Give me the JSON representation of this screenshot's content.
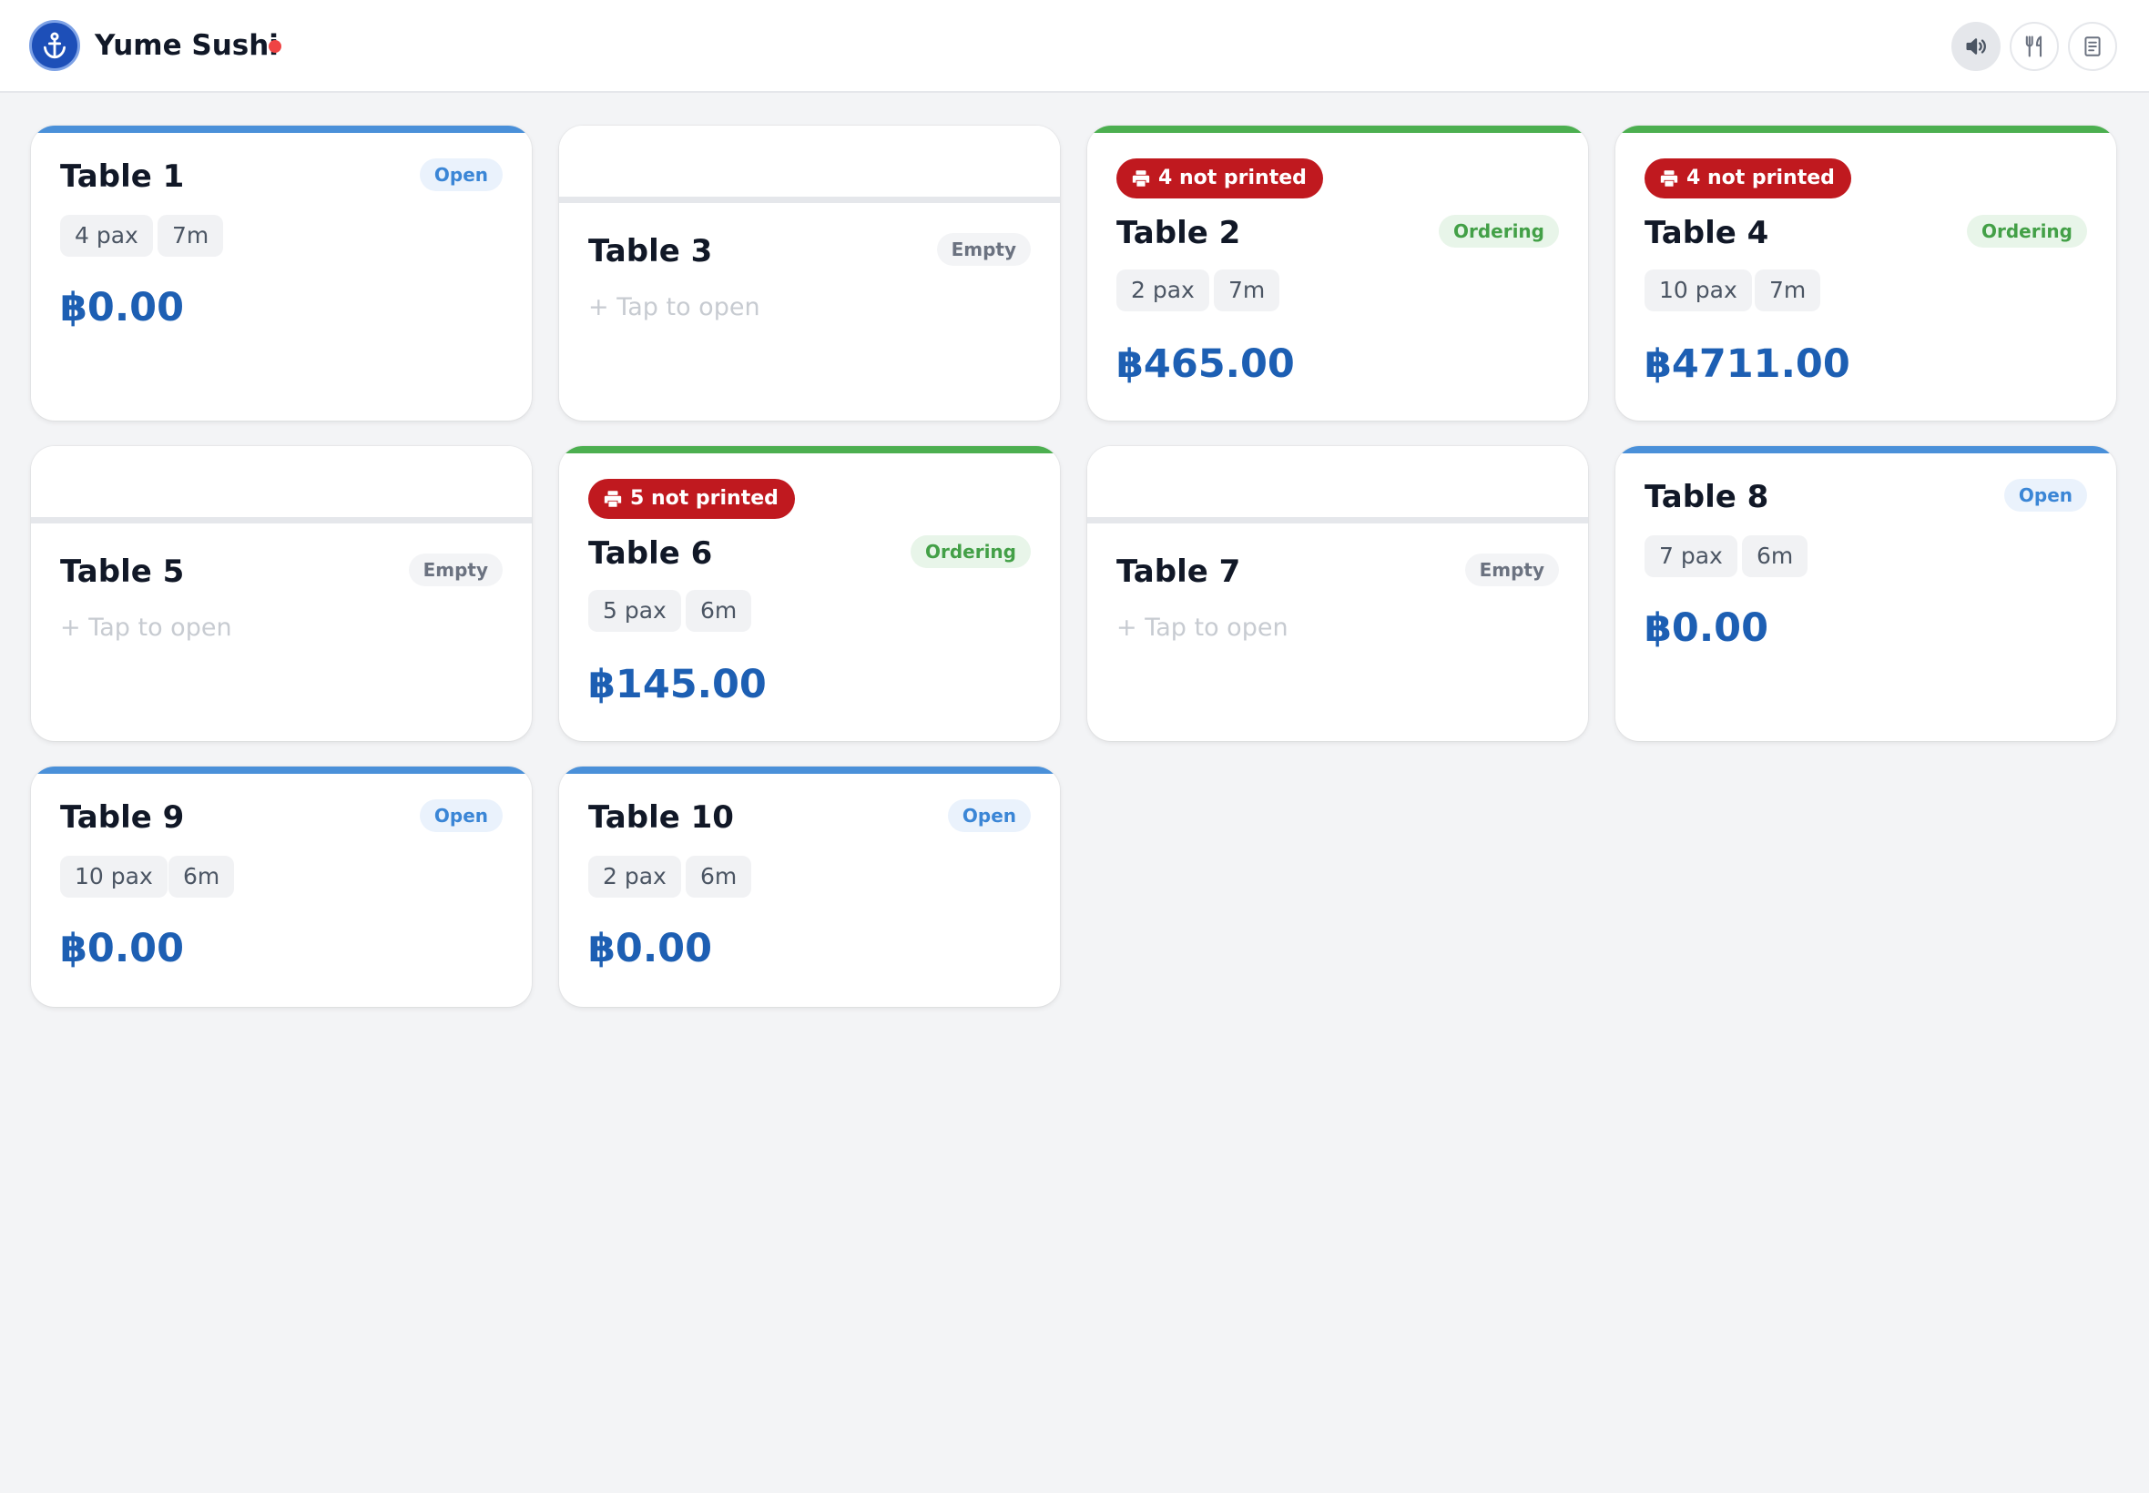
{
  "app": {
    "title": "Yume Sushi",
    "connection_dot_color": "#ef4444",
    "logo_icon": "anchor-icon"
  },
  "header_actions": [
    {
      "name": "sound-button",
      "icon": "speaker-icon",
      "active": true
    },
    {
      "name": "menu-button",
      "icon": "utensils-icon",
      "active": false
    },
    {
      "name": "orders-button",
      "icon": "receipt-icon",
      "active": false
    }
  ],
  "colors": {
    "open": "#4a90d9",
    "ordering": "#4caf50",
    "not_printed": "#c0191f",
    "amount": "#1d5fb3"
  },
  "tables": [
    {
      "name": "Table 1",
      "status": "Open",
      "pax": "4 pax",
      "time": "7m",
      "amount": "฿0.00"
    },
    {
      "name": "Table 3",
      "status": "Empty",
      "hint": "+ Tap to open"
    },
    {
      "name": "Table 2",
      "status": "Ordering",
      "not_printed": "4 not printed",
      "pax": "2 pax",
      "time": "7m",
      "amount": "฿465.00"
    },
    {
      "name": "Table 4",
      "status": "Ordering",
      "not_printed": "4 not printed",
      "pax": "10 pax",
      "time": "7m",
      "amount": "฿4711.00"
    },
    {
      "name": "Table 5",
      "status": "Empty",
      "hint": "+ Tap to open"
    },
    {
      "name": "Table 6",
      "status": "Ordering",
      "not_printed": "5 not printed",
      "pax": "5 pax",
      "time": "6m",
      "amount": "฿145.00"
    },
    {
      "name": "Table 7",
      "status": "Empty",
      "hint": "+ Tap to open"
    },
    {
      "name": "Table 8",
      "status": "Open",
      "pax": "7 pax",
      "time": "6m",
      "amount": "฿0.00"
    },
    {
      "name": "Table 9",
      "status": "Open",
      "pax": "10 pax",
      "time": "6m",
      "amount": "฿0.00"
    },
    {
      "name": "Table 10",
      "status": "Open",
      "pax": "2 pax",
      "time": "6m",
      "amount": "฿0.00"
    }
  ]
}
